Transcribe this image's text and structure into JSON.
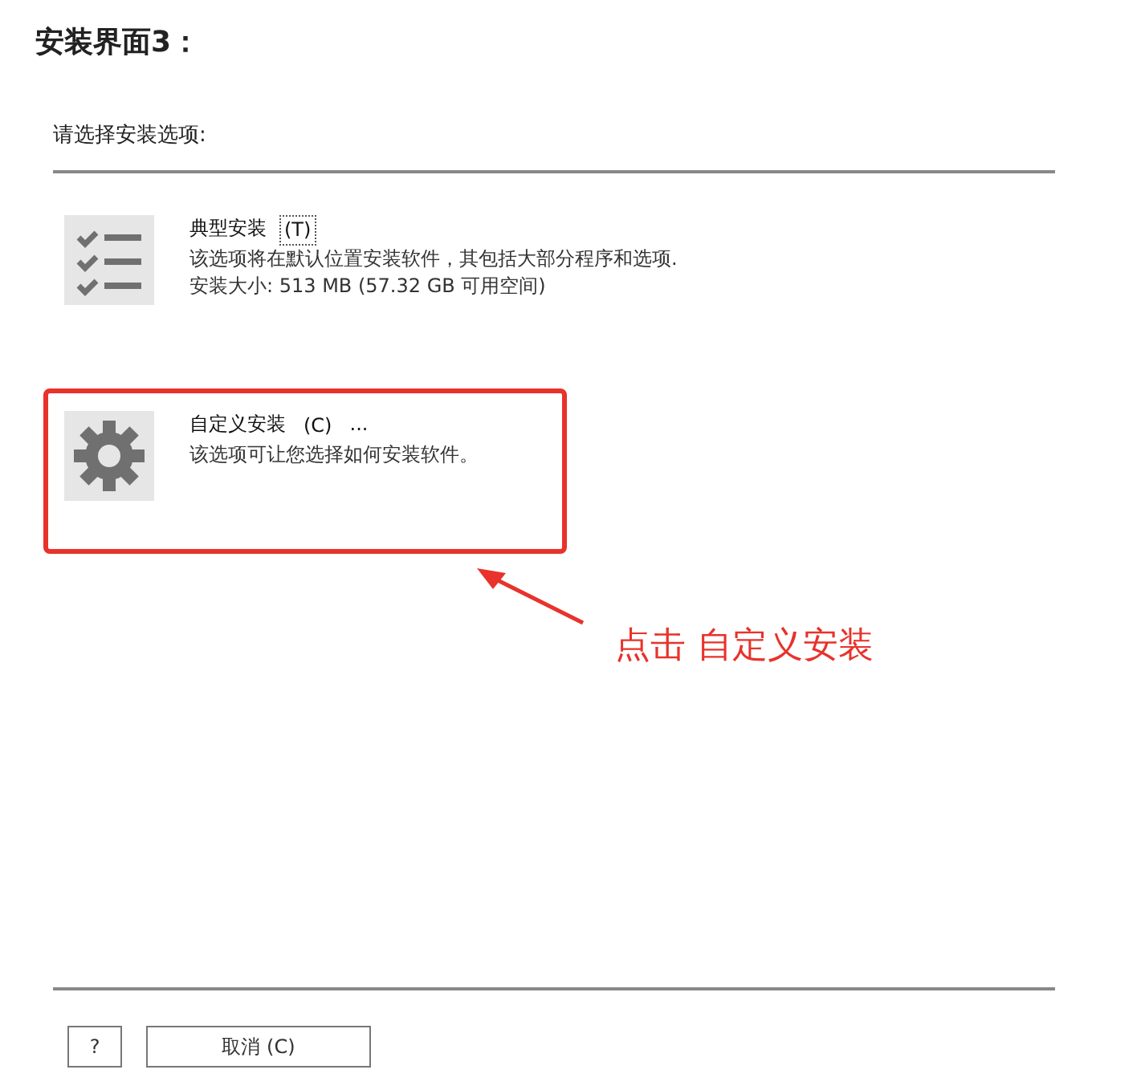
{
  "heading": "安装界面3：",
  "prompt": "请选择安装选项:",
  "options": [
    {
      "kind": "checklist",
      "title": "典型安装",
      "shortcut": "(T)",
      "focused": true,
      "highlighted": false,
      "lines": [
        "该选项将在默认位置安装软件，其包括大部分程序和选项.",
        "安装大小: 513 MB (57.32 GB 可用空间)"
      ]
    },
    {
      "kind": "gear",
      "title": "自定义安装",
      "shortcut": "(C)",
      "suffix": "...",
      "focused": false,
      "highlighted": true,
      "lines": [
        "该选项可让您选择如何安装软件。"
      ]
    }
  ],
  "annotation": "点击 自定义安装",
  "buttons": [
    {
      "kind": "help",
      "label": "?"
    },
    {
      "kind": "cancel",
      "label": "取消 (C)"
    }
  ]
}
